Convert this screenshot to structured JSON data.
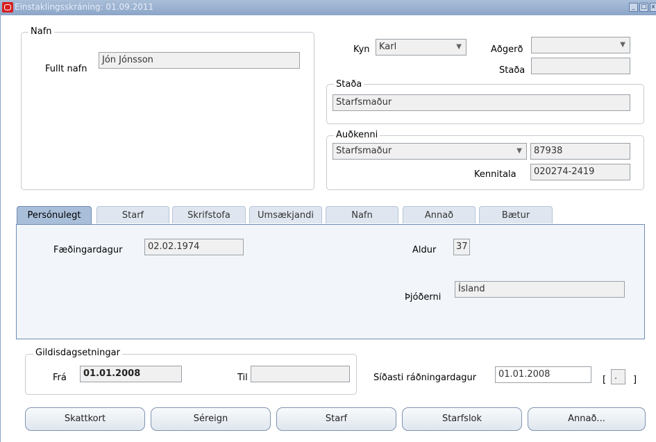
{
  "window": {
    "title": "Einstaklingsskráning: 01.09.2011",
    "min": "_",
    "max": "□",
    "close": "x"
  },
  "name_group": {
    "legend": "Nafn",
    "full_name_label": "Fullt nafn",
    "full_name_value": "Jón Jónsson"
  },
  "header": {
    "gender_label": "Kyn",
    "gender_value": "Karl",
    "action_label": "Aðgerð",
    "action_value": "",
    "status_label": "Staða",
    "status_value": ""
  },
  "status_group": {
    "legend": "Staða",
    "value": "Starfsmaður"
  },
  "identity_group": {
    "legend": "Auðkenni",
    "type_value": "Starfsmaður",
    "number_value": "87938",
    "ssn_label": "Kennitala",
    "ssn_value": "020274-2419"
  },
  "tabs": [
    "Persónulegt",
    "Starf",
    "Skrifstofa",
    "Umsækjandi",
    "Nafn",
    "Annað",
    "Bætur"
  ],
  "personal": {
    "birthdate_label": "Fæðingardagur",
    "birthdate_value": "02.02.1974",
    "age_label": "Aldur",
    "age_value": "37",
    "nationality_label": "Þjóðerni",
    "nationality_value": "Ísland"
  },
  "validity": {
    "legend": "Gildisdagsetningar",
    "from_label": "Frá",
    "from_value": "01.01.2008",
    "to_label": "Til",
    "to_value": ""
  },
  "last_hire": {
    "label": "Síðasti ráðningardagur",
    "value": "01.01.2008",
    "bracket_open": "[",
    "bracket_value": ".",
    "bracket_close": "]"
  },
  "buttons": [
    "Skattkort",
    "Séreign",
    "Starf",
    "Starfslok",
    "Annað..."
  ]
}
